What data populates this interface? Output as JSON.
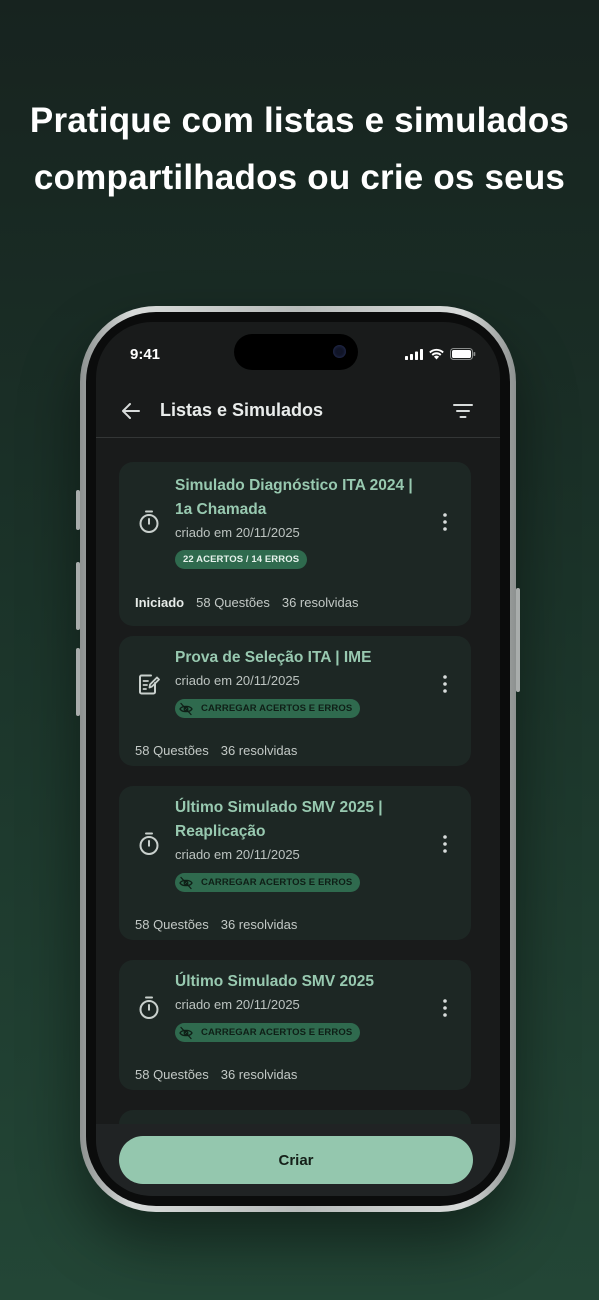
{
  "headline": {
    "line1": "Pratique com listas e simulados",
    "line2": "compartilhados ou crie os seus"
  },
  "status_bar": {
    "time": "9:41"
  },
  "appbar": {
    "back_icon": "arrow-left-icon",
    "title": "Listas e Simulados",
    "filter_icon": "filter-icon"
  },
  "cards": [
    {
      "icon": "stopwatch-icon",
      "title_line1": "Simulado Diagnóstico ITA 2024 |",
      "title_line2": "1a Chamada",
      "date": "criado em 20/11/2025",
      "badge": "22 ACERTOS / 14 ERROS",
      "status": "Iniciado",
      "questions": "58 Questões",
      "resolved": "36 resolvidas"
    },
    {
      "icon": "edit-document-icon",
      "title_line1": "Prova de Seleção ITA | IME",
      "date": "criado em 20/11/2025",
      "badge": "CARREGAR ACERTOS E ERROS",
      "questions": "58 Questões",
      "resolved": "36 resolvidas"
    },
    {
      "icon": "stopwatch-icon",
      "title_line1": "Último Simulado SMV 2025 |",
      "title_line2": "Reaplicação",
      "date": "criado em 20/11/2025",
      "badge": "CARREGAR ACERTOS E ERROS",
      "questions": "58 Questões",
      "resolved": "36 resolvidas"
    },
    {
      "icon": "stopwatch-icon",
      "title_line1": "Último Simulado SMV 2025",
      "date": "criado em 20/11/2025",
      "badge": "CARREGAR ACERTOS E ERROS",
      "questions": "58 Questões",
      "resolved": "36 resolvidas"
    }
  ],
  "create_button": {
    "label": "Criar"
  },
  "colors": {
    "accent": "#94c7ae",
    "title_green": "#98c9b0",
    "badge_bg": "#2f6a4e",
    "card_bg": "#1d2724",
    "screen_bg": "#191b1b"
  }
}
